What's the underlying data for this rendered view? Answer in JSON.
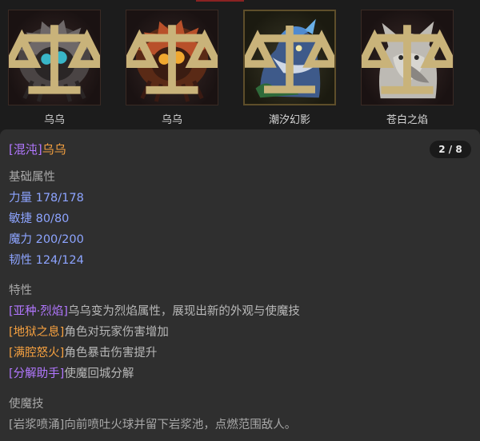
{
  "cards": [
    {
      "name": "乌乌"
    },
    {
      "name": "乌乌"
    },
    {
      "name": "潮汐幻影"
    },
    {
      "name": "苍白之焰"
    }
  ],
  "panel": {
    "tag": "[混沌]",
    "name": "乌乌",
    "pager": "2 / 8",
    "attributes": {
      "title": "基础属性",
      "items": [
        "力量 178/178",
        "敏捷 80/80",
        "魔力 200/200",
        "韧性 124/124"
      ]
    },
    "traits": {
      "title": "特性",
      "items": [
        {
          "name": "[亚种·烈焰]",
          "desc": "乌乌变为烈焰属性，展现出新的外观与使魔技",
          "color": "#b277ff"
        },
        {
          "name": "[地狱之息]",
          "desc": "角色对玩家伤害增加",
          "color": "#f6a140"
        },
        {
          "name": "[满腔怒火]",
          "desc": "角色暴击伤害提升",
          "color": "#f6a140"
        },
        {
          "name": "[分解助手]",
          "desc": "使魔回城分解",
          "color": "#b277ff"
        }
      ]
    },
    "skill": {
      "title": "使魔技",
      "text": "[岩浆喷涌]向前喷吐火球并留下岩浆池，点燃范围敌人。"
    }
  },
  "colors": {
    "accent_purple": "#b277ff",
    "accent_orange": "#f6a140",
    "stat_blue": "#8da4ff"
  }
}
